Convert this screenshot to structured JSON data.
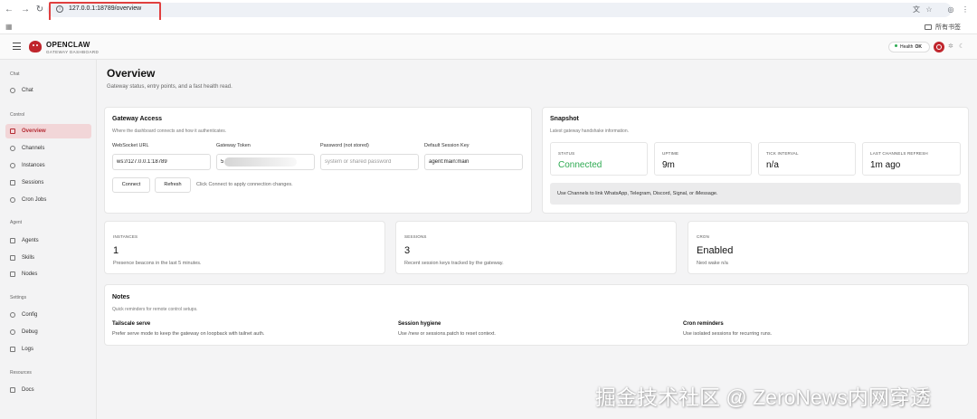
{
  "browser": {
    "url": "127.0.0.1:18789/overview",
    "all_bookmarks": "所有书签"
  },
  "header": {
    "brand_name": "OPENCLAW",
    "brand_sub": "GATEWAY DASHBOARD",
    "health_label": "Health",
    "health_status": "OK",
    "health_color": "#2eaa52",
    "accent_color": "#c0262d"
  },
  "sidebar": {
    "sections": [
      {
        "title": "Chat",
        "items": [
          {
            "label": "Chat",
            "icon": "chat-bubble-icon"
          }
        ]
      },
      {
        "title": "Control",
        "items": [
          {
            "label": "Overview",
            "icon": "bar-chart-icon",
            "active": true
          },
          {
            "label": "Channels",
            "icon": "link-icon"
          },
          {
            "label": "Instances",
            "icon": "radio-icon"
          },
          {
            "label": "Sessions",
            "icon": "document-icon"
          },
          {
            "label": "Cron Jobs",
            "icon": "clock-icon"
          }
        ]
      },
      {
        "title": "Agent",
        "items": [
          {
            "label": "Agents",
            "icon": "folder-icon"
          },
          {
            "label": "Skills",
            "icon": "lightning-icon"
          },
          {
            "label": "Nodes",
            "icon": "monitor-icon"
          }
        ]
      },
      {
        "title": "Settings",
        "items": [
          {
            "label": "Config",
            "icon": "gear-icon"
          },
          {
            "label": "Debug",
            "icon": "bug-icon"
          },
          {
            "label": "Logs",
            "icon": "file-text-icon"
          }
        ]
      },
      {
        "title": "Resources",
        "items": [
          {
            "label": "Docs",
            "icon": "book-icon"
          }
        ]
      }
    ]
  },
  "main": {
    "title": "Overview",
    "subtitle": "Gateway status, entry points, and a fast health read."
  },
  "gateway_access": {
    "title": "Gateway Access",
    "subtitle": "Where the dashboard connects and how it authenticates.",
    "websocket_label": "WebSocket URL",
    "websocket_value": "ws://127.0.0.1:18789",
    "token_label": "Gateway Token",
    "token_value": "5",
    "password_label": "Password (not stored)",
    "password_placeholder": "system or shared password",
    "session_key_label": "Default Session Key",
    "session_key_value": "agent:main:main",
    "connect_label": "Connect",
    "refresh_label": "Refresh",
    "hint": "Click Connect to apply connection changes."
  },
  "snapshot": {
    "title": "Snapshot",
    "subtitle": "Latest gateway handshake information.",
    "status_label": "STATUS",
    "status_value": "Connected",
    "uptime_label": "UPTIME",
    "uptime_value": "9m",
    "tick_label": "TICK INTERVAL",
    "tick_value": "n/a",
    "refresh_label": "LAST CHANNELS REFRESH",
    "refresh_value": "1m ago",
    "info": "Use Channels to link WhatsApp, Telegram, Discord, Signal, or iMessage."
  },
  "metrics": {
    "instances": {
      "label": "INSTANCES",
      "value": "1",
      "sub": "Presence beacons in the last 5 minutes."
    },
    "sessions": {
      "label": "SESSIONS",
      "value": "3",
      "sub": "Recent session keys tracked by the gateway."
    },
    "cron": {
      "label": "CRON",
      "value": "Enabled",
      "sub": "Next wake n/a"
    }
  },
  "notes": {
    "title": "Notes",
    "subtitle": "Quick reminders for remote control setups.",
    "items": [
      {
        "title": "Tailscale serve",
        "text": "Prefer serve mode to keep the gateway on loopback with tailnet auth."
      },
      {
        "title": "Session hygiene",
        "text": "Use /new or sessions.patch to reset context."
      },
      {
        "title": "Cron reminders",
        "text": "Use isolated sessions for recurring runs."
      }
    ]
  },
  "watermark": "掘金技术社区 @ ZeroNews内网穿透"
}
